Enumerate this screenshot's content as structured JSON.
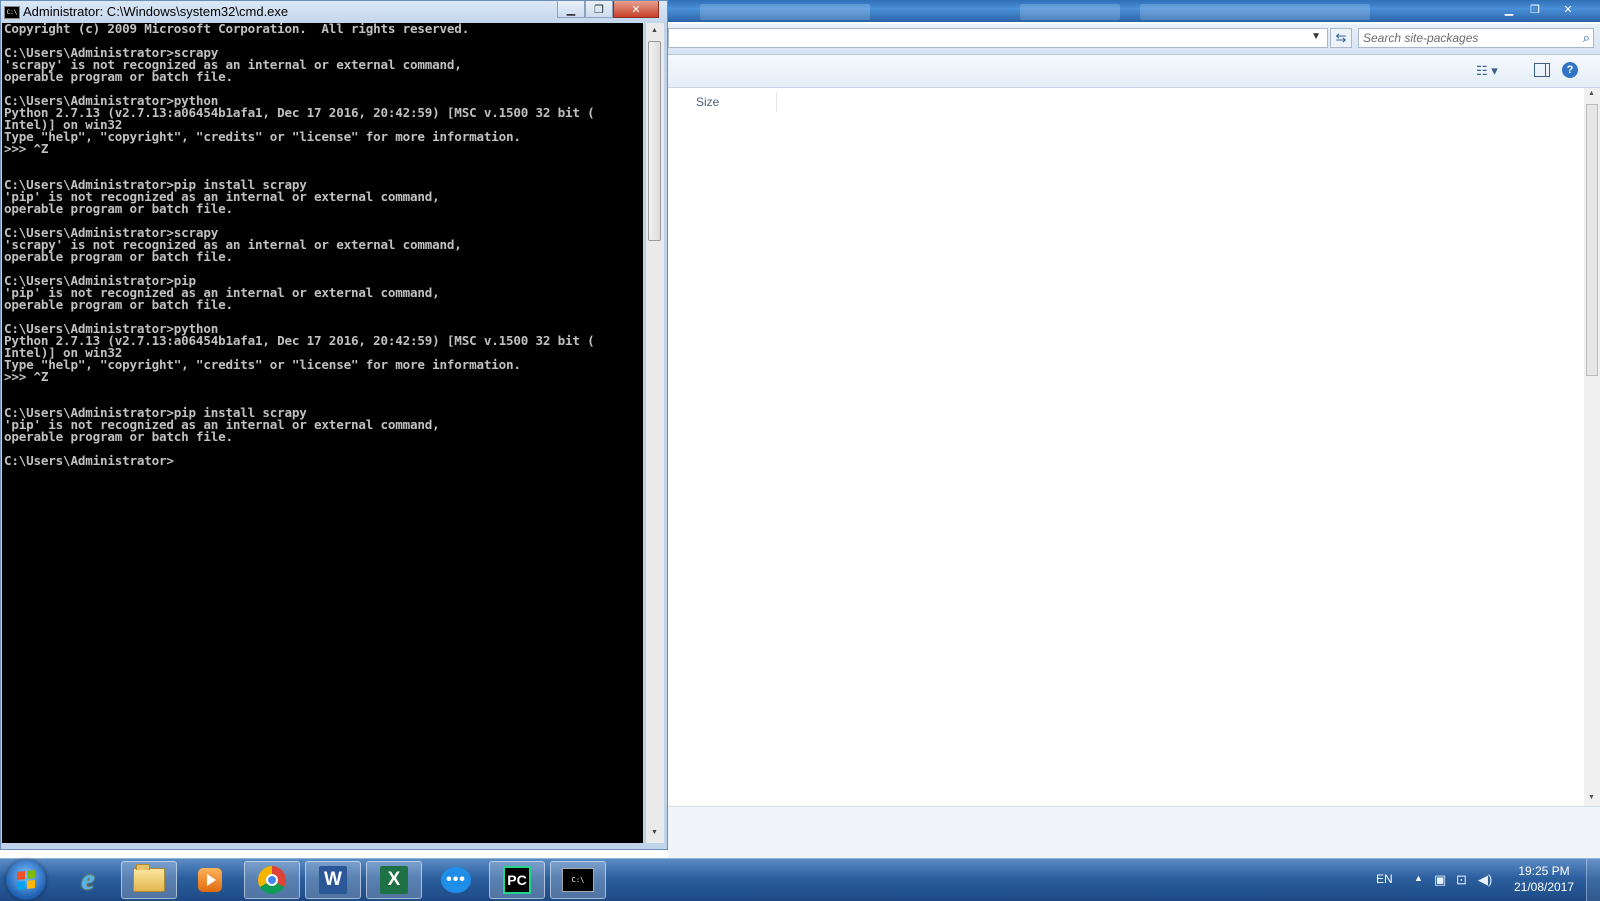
{
  "explorer": {
    "search_placeholder": "Search site-packages",
    "column_size": "Size",
    "icons": [
      "refresh-icon",
      "search-icon",
      "view-options-icon",
      "preview-pane-icon",
      "help-icon"
    ]
  },
  "cmd": {
    "title": "Administrator: C:\\Windows\\system32\\cmd.exe",
    "icon_text": "C:\\",
    "lines": [
      "Copyright (c) 2009 Microsoft Corporation.  All rights reserved.",
      "",
      "C:\\Users\\Administrator>scrapy",
      "'scrapy' is not recognized as an internal or external command,",
      "operable program or batch file.",
      "",
      "C:\\Users\\Administrator>python",
      "Python 2.7.13 (v2.7.13:a06454b1afa1, Dec 17 2016, 20:42:59) [MSC v.1500 32 bit (",
      "Intel)] on win32",
      "Type \"help\", \"copyright\", \"credits\" or \"license\" for more information.",
      ">>> ^Z",
      "",
      "",
      "C:\\Users\\Administrator>pip install scrapy",
      "'pip' is not recognized as an internal or external command,",
      "operable program or batch file.",
      "",
      "C:\\Users\\Administrator>scrapy",
      "'scrapy' is not recognized as an internal or external command,",
      "operable program or batch file.",
      "",
      "C:\\Users\\Administrator>pip",
      "'pip' is not recognized as an internal or external command,",
      "operable program or batch file.",
      "",
      "C:\\Users\\Administrator>python",
      "Python 2.7.13 (v2.7.13:a06454b1afa1, Dec 17 2016, 20:42:59) [MSC v.1500 32 bit (",
      "Intel)] on win32",
      "Type \"help\", \"copyright\", \"credits\" or \"license\" for more information.",
      ">>> ^Z",
      "",
      "",
      "C:\\Users\\Administrator>pip install scrapy",
      "'pip' is not recognized as an internal or external command,",
      "operable program or batch file.",
      "",
      "C:\\Users\\Administrator>"
    ]
  },
  "taskbar": {
    "apps": [
      "start-button",
      "internet-explorer",
      "windows-explorer",
      "media-player",
      "google-chrome",
      "microsoft-word",
      "microsoft-excel",
      "messenger",
      "pycharm",
      "command-prompt"
    ],
    "word_letter": "W",
    "excel_letter": "X",
    "pycharm_label": "PC",
    "chat_glyph": "•••",
    "tray": {
      "language": "EN",
      "time": "19:25 PM",
      "date": "21/08/2017"
    }
  },
  "colors": {
    "console_bg": "#000000",
    "console_fg": "#c0c0c0",
    "taskbar": "#2c5f9e",
    "close_button": "#c8412a"
  }
}
